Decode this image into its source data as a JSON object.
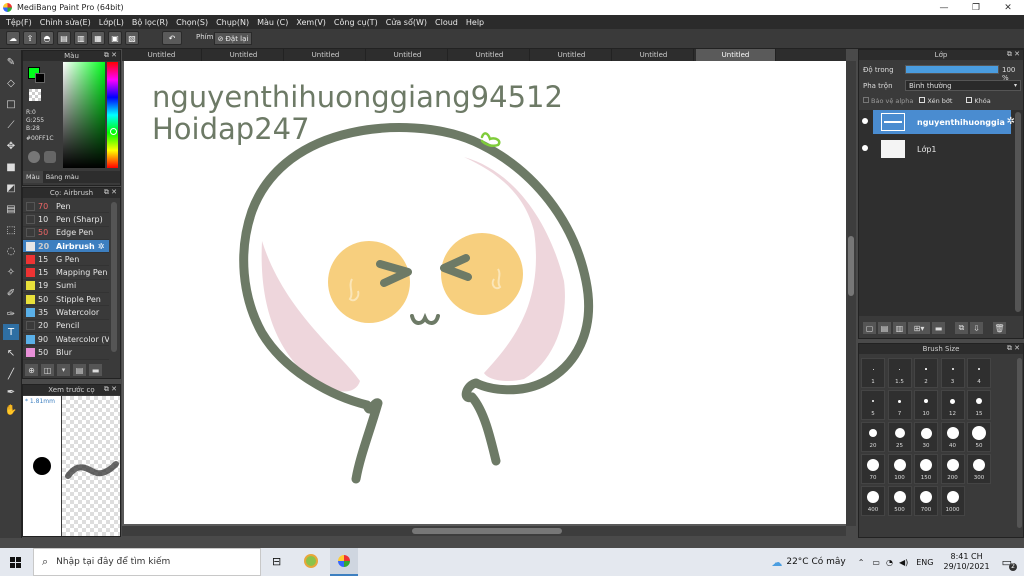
{
  "window": {
    "title": "MediBang Paint Pro (64bit)"
  },
  "menu": [
    "Tệp(F)",
    "Chỉnh sửa(E)",
    "Lớp(L)",
    "Bộ lọc(R)",
    "Chọn(S)",
    "Chụp(N)",
    "Màu (C)",
    "Xem(V)",
    "Công cụ(T)",
    "Cửa sổ(W)",
    "Cloud",
    "Help"
  ],
  "toolbar": {
    "shortcut_label": "Phím",
    "reset_label": "Đặt lại"
  },
  "tabs": [
    "Untitled",
    "Untitled",
    "Untitled",
    "Untitled",
    "Untitled",
    "Untitled",
    "Untitled",
    "Untitled"
  ],
  "color_panel": {
    "title": "Màu",
    "r": "R:0",
    "g": "G:255",
    "b": "B:28",
    "hex": "#00FF1C",
    "tab_color": "Màu",
    "tab_palette": "Bảng màu",
    "current_color": "#00ff1c"
  },
  "brush_panel": {
    "title": "Cọ: Airbrush",
    "items": [
      {
        "num": "70",
        "name": "Pen",
        "color": "#3a3a3a"
      },
      {
        "num": "10",
        "name": "Pen (Sharp)",
        "color": "#3a3a3a"
      },
      {
        "num": "50",
        "name": "Edge Pen",
        "color": "#3a3a3a"
      },
      {
        "num": "20",
        "name": "Airbrush",
        "color": "#e6e6e6"
      },
      {
        "num": "15",
        "name": "G Pen",
        "color": "#e33"
      },
      {
        "num": "15",
        "name": "Mapping Pen",
        "color": "#e33"
      },
      {
        "num": "19",
        "name": "Sumi",
        "color": "#e8e03a"
      },
      {
        "num": "50",
        "name": "Stipple Pen",
        "color": "#e8e03a"
      },
      {
        "num": "35",
        "name": "Watercolor",
        "color": "#5ab0e8"
      },
      {
        "num": "20",
        "name": "Pencil",
        "color": "#3a3a3a"
      },
      {
        "num": "90",
        "name": "Watercolor (V",
        "color": "#5ab0e8"
      },
      {
        "num": "50",
        "name": "Blur",
        "color": "#e890d8"
      }
    ]
  },
  "preview_panel": {
    "title": "Xem trước cọ",
    "size": "* 1.81mm"
  },
  "canvas": {
    "text_line1": "nguyenthihuonggiang94512",
    "text_line2": "Hoidap247"
  },
  "layer_panel": {
    "title": "Lớp",
    "opacity_label": "Độ trong",
    "opacity_value": "100 %",
    "opacity_level": 1.0,
    "blend_label": "Pha trộn",
    "blend_value": "Bình thường",
    "protect_alpha": "Bảo vệ alpha",
    "clipping": "Xén bớt",
    "lock": "Khóa",
    "layers": [
      {
        "name": "nguyenthihuonggia"
      },
      {
        "name": "Lớp1"
      }
    ]
  },
  "brushsize_panel": {
    "title": "Brush Size",
    "sizes": [
      "1",
      "1.5",
      "2",
      "3",
      "4",
      "5",
      "7",
      "10",
      "12",
      "15",
      "20",
      "25",
      "30",
      "40",
      "50",
      "70",
      "100",
      "150",
      "200",
      "300",
      "400",
      "500",
      "700",
      "1000"
    ]
  },
  "taskbar": {
    "search_placeholder": "Nhập tại đây để tìm kiếm",
    "weather": "22°C  Có mây",
    "lang": "ENG",
    "time": "8:41 CH",
    "date": "29/10/2021",
    "notification_count": "2"
  },
  "colors": {
    "stroke": "#6d7a66",
    "cheek": "#f7cf7e",
    "blush": "#eed6dc",
    "leaf": "#7fcc3a",
    "accent": "#3d7fc0"
  }
}
